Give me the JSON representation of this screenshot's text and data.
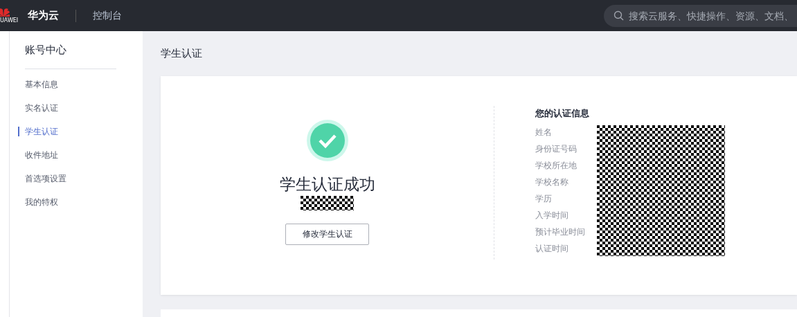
{
  "topbar": {
    "logo_text": "UAWEI",
    "brand": "华为云",
    "console": "控制台",
    "search": {
      "placeholder": "搜索云服务、快捷操作、资源、文档、"
    }
  },
  "sidebar": {
    "title": "账号中心",
    "items": [
      {
        "label": "基本信息",
        "selected": false
      },
      {
        "label": "实名认证",
        "selected": false
      },
      {
        "label": "学生认证",
        "selected": true
      },
      {
        "label": "收件地址",
        "selected": false
      },
      {
        "label": "首选项设置",
        "selected": false
      },
      {
        "label": "我的特权",
        "selected": false
      }
    ]
  },
  "page_title": "学生认证",
  "result": {
    "title": "学生认证成功",
    "button": "修改学生认证"
  },
  "info": {
    "heading": "您的认证信息",
    "fields": [
      "姓名",
      "身份证号码",
      "学校所在地",
      "学校名称",
      "学历",
      "入学时间",
      "预计毕业时间",
      "认证时间"
    ]
  }
}
